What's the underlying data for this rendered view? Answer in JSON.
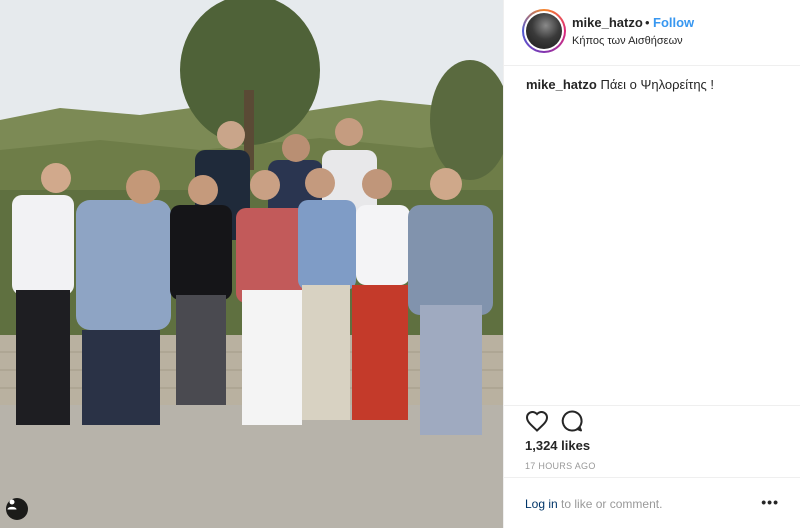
{
  "post": {
    "username": "mike_hatzo",
    "separator": "•",
    "follow_label": "Follow",
    "location": "Κήπος των Αισθήσεων",
    "caption_user": "mike_hatzo",
    "caption_text": "Πάει ο Ψηλορείτης !",
    "likes": "1,324 likes",
    "time": "17 HOURS AGO",
    "login_link": "Log in",
    "login_suffix": " to like or comment.",
    "more_label": "•••"
  },
  "icons": {
    "like": "heart-icon",
    "comment": "comment-icon",
    "user_tag": "user-tag-icon",
    "more": "more-options-icon"
  },
  "colors": {
    "link_blue": "#3897f0",
    "login_blue": "#003569",
    "meta_grey": "#999999",
    "text": "#262626",
    "border": "#efefef"
  }
}
